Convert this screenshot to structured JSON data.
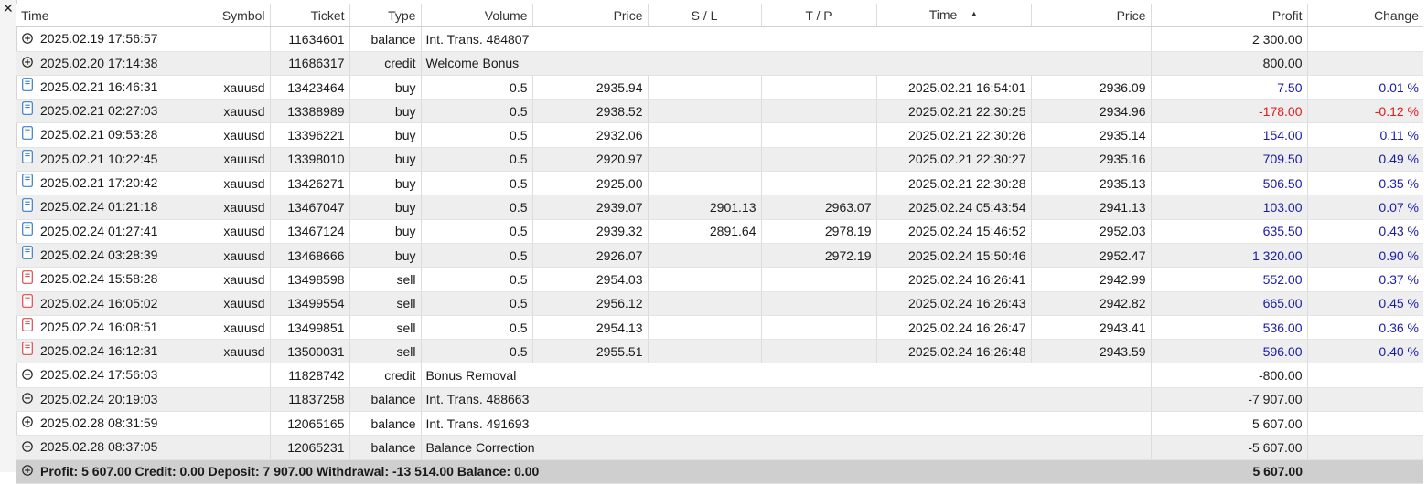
{
  "window": {
    "close_glyph": "✕"
  },
  "headers": [
    "Time",
    "Symbol",
    "Ticket",
    "Type",
    "Volume",
    "Price",
    "S / L",
    "T / P",
    "Time",
    "Price",
    "Profit",
    "Change"
  ],
  "sort_indicator": "▲",
  "rows": [
    {
      "kind": "plus",
      "time": "2025.02.19 17:56:57",
      "symbol": "",
      "ticket": "11634601",
      "type": "balance",
      "comment": "Int. Trans. 484807",
      "profit": "2 300.00",
      "profit_color": "black"
    },
    {
      "kind": "plus",
      "time": "2025.02.20 17:14:38",
      "symbol": "",
      "ticket": "11686317",
      "type": "credit",
      "comment": "Welcome Bonus",
      "profit": "800.00",
      "profit_color": "black"
    },
    {
      "kind": "buy",
      "time": "2025.02.21 16:46:31",
      "symbol": "xauusd",
      "ticket": "13423464",
      "type": "buy",
      "volume": "0.5",
      "price": "2935.94",
      "sl": "",
      "tp": "",
      "close_time": "2025.02.21 16:54:01",
      "close_price": "2936.09",
      "profit": "7.50",
      "change": "0.01 %",
      "profit_color": "blue"
    },
    {
      "kind": "buy",
      "time": "2025.02.21 02:27:03",
      "symbol": "xauusd",
      "ticket": "13388989",
      "type": "buy",
      "volume": "0.5",
      "price": "2938.52",
      "sl": "",
      "tp": "",
      "close_time": "2025.02.21 22:30:25",
      "close_price": "2934.96",
      "profit": "-178.00",
      "change": "-0.12 %",
      "profit_color": "red"
    },
    {
      "kind": "buy",
      "time": "2025.02.21 09:53:28",
      "symbol": "xauusd",
      "ticket": "13396221",
      "type": "buy",
      "volume": "0.5",
      "price": "2932.06",
      "sl": "",
      "tp": "",
      "close_time": "2025.02.21 22:30:26",
      "close_price": "2935.14",
      "profit": "154.00",
      "change": "0.11 %",
      "profit_color": "blue"
    },
    {
      "kind": "buy",
      "time": "2025.02.21 10:22:45",
      "symbol": "xauusd",
      "ticket": "13398010",
      "type": "buy",
      "volume": "0.5",
      "price": "2920.97",
      "sl": "",
      "tp": "",
      "close_time": "2025.02.21 22:30:27",
      "close_price": "2935.16",
      "profit": "709.50",
      "change": "0.49 %",
      "profit_color": "blue"
    },
    {
      "kind": "buy",
      "time": "2025.02.21 17:20:42",
      "symbol": "xauusd",
      "ticket": "13426271",
      "type": "buy",
      "volume": "0.5",
      "price": "2925.00",
      "sl": "",
      "tp": "",
      "close_time": "2025.02.21 22:30:28",
      "close_price": "2935.13",
      "profit": "506.50",
      "change": "0.35 %",
      "profit_color": "blue"
    },
    {
      "kind": "buy",
      "time": "2025.02.24 01:21:18",
      "symbol": "xauusd",
      "ticket": "13467047",
      "type": "buy",
      "volume": "0.5",
      "price": "2939.07",
      "sl": "2901.13",
      "tp": "2963.07",
      "close_time": "2025.02.24 05:43:54",
      "close_price": "2941.13",
      "profit": "103.00",
      "change": "0.07 %",
      "profit_color": "blue"
    },
    {
      "kind": "buy",
      "time": "2025.02.24 01:27:41",
      "symbol": "xauusd",
      "ticket": "13467124",
      "type": "buy",
      "volume": "0.5",
      "price": "2939.32",
      "sl": "2891.64",
      "tp": "2978.19",
      "close_time": "2025.02.24 15:46:52",
      "close_price": "2952.03",
      "profit": "635.50",
      "change": "0.43 %",
      "profit_color": "blue"
    },
    {
      "kind": "buy",
      "time": "2025.02.24 03:28:39",
      "symbol": "xauusd",
      "ticket": "13468666",
      "type": "buy",
      "volume": "0.5",
      "price": "2926.07",
      "sl": "",
      "tp": "2972.19",
      "close_time": "2025.02.24 15:50:46",
      "close_price": "2952.47",
      "profit": "1 320.00",
      "change": "0.90 %",
      "profit_color": "blue"
    },
    {
      "kind": "sell",
      "time": "2025.02.24 15:58:28",
      "symbol": "xauusd",
      "ticket": "13498598",
      "type": "sell",
      "volume": "0.5",
      "price": "2954.03",
      "sl": "",
      "tp": "",
      "close_time": "2025.02.24 16:26:41",
      "close_price": "2942.99",
      "profit": "552.00",
      "change": "0.37 %",
      "profit_color": "blue"
    },
    {
      "kind": "sell",
      "time": "2025.02.24 16:05:02",
      "symbol": "xauusd",
      "ticket": "13499554",
      "type": "sell",
      "volume": "0.5",
      "price": "2956.12",
      "sl": "",
      "tp": "",
      "close_time": "2025.02.24 16:26:43",
      "close_price": "2942.82",
      "profit": "665.00",
      "change": "0.45 %",
      "profit_color": "blue"
    },
    {
      "kind": "sell",
      "time": "2025.02.24 16:08:51",
      "symbol": "xauusd",
      "ticket": "13499851",
      "type": "sell",
      "volume": "0.5",
      "price": "2954.13",
      "sl": "",
      "tp": "",
      "close_time": "2025.02.24 16:26:47",
      "close_price": "2943.41",
      "profit": "536.00",
      "change": "0.36 %",
      "profit_color": "blue"
    },
    {
      "kind": "sell",
      "time": "2025.02.24 16:12:31",
      "symbol": "xauusd",
      "ticket": "13500031",
      "type": "sell",
      "volume": "0.5",
      "price": "2955.51",
      "sl": "",
      "tp": "",
      "close_time": "2025.02.24 16:26:48",
      "close_price": "2943.59",
      "profit": "596.00",
      "change": "0.40 %",
      "profit_color": "blue"
    },
    {
      "kind": "minus",
      "time": "2025.02.24 17:56:03",
      "symbol": "",
      "ticket": "11828742",
      "type": "credit",
      "comment": "Bonus Removal",
      "profit": "-800.00",
      "profit_color": "black"
    },
    {
      "kind": "minus",
      "time": "2025.02.24 20:19:03",
      "symbol": "",
      "ticket": "11837258",
      "type": "balance",
      "comment": "Int. Trans. 488663",
      "profit": "-7 907.00",
      "profit_color": "black"
    },
    {
      "kind": "plus",
      "time": "2025.02.28 08:31:59",
      "symbol": "",
      "ticket": "12065165",
      "type": "balance",
      "comment": "Int. Trans. 491693",
      "profit": "5 607.00",
      "profit_color": "black"
    },
    {
      "kind": "minus",
      "time": "2025.02.28 08:37:05",
      "symbol": "",
      "ticket": "12065231",
      "type": "balance",
      "comment": "Balance Correction",
      "profit": "-5 607.00",
      "profit_color": "black"
    }
  ],
  "summary": {
    "text": "Profit: 5 607.00  Credit: 0.00  Deposit: 7 907.00  Withdrawal: -13 514.00  Balance: 0.00",
    "profit": "5 607.00"
  },
  "colors": {
    "blue": "#1a1aa8",
    "red": "#e11b1b",
    "buy_icon": "#3a7dc9",
    "sell_icon": "#d94b4b"
  }
}
